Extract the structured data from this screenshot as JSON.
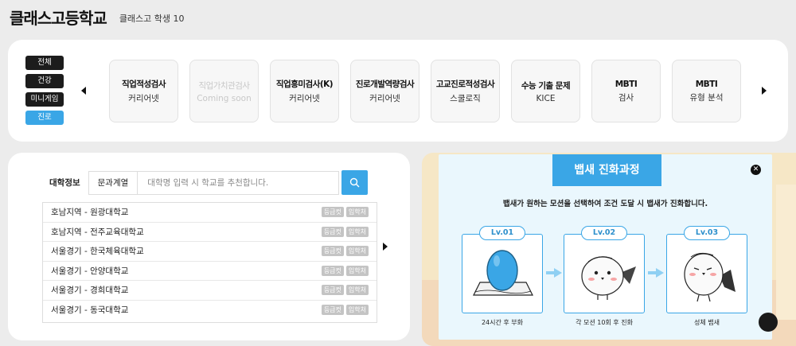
{
  "header": {
    "school_name": "클래스고등학교",
    "student_label": "클래스고 학생 10"
  },
  "categories": [
    {
      "label": "전체",
      "active": false
    },
    {
      "label": "건강",
      "active": false
    },
    {
      "label": "미니게임",
      "active": false
    },
    {
      "label": "진로",
      "active": true
    }
  ],
  "tests": [
    {
      "title": "직업적성검사",
      "sub": "커리어넷",
      "disabled": false
    },
    {
      "title": "직업가치관검사",
      "sub": "Coming soon",
      "disabled": true
    },
    {
      "title": "직업흥미검사(K)",
      "sub": "커리어넷",
      "disabled": false
    },
    {
      "title": "진로개발역량검사",
      "sub": "커리어넷",
      "disabled": false
    },
    {
      "title": "고교진로적성검사",
      "sub": "스쿨로직",
      "disabled": false
    },
    {
      "title": "수능 기출 문제",
      "sub": "KICE",
      "disabled": false
    },
    {
      "title": "MBTI",
      "sub": "검사",
      "disabled": false
    },
    {
      "title": "MBTI",
      "sub": "유형 분석",
      "disabled": false
    }
  ],
  "university": {
    "tab_label": "대학정보",
    "dropdown_value": "문과계열",
    "search_placeholder": "대학명 입력 시 학교를 추천합니다.",
    "tag_grade": "등급컷",
    "tag_admission": "입학처",
    "rows": [
      "호남지역 - 원광대학교",
      "호남지역 - 전주교육대학교",
      "서울경기 - 한국체육대학교",
      "서울경기 - 안양대학교",
      "서울경기 - 경희대학교",
      "서울경기 - 동국대학교"
    ]
  },
  "modal": {
    "title": "뱁새 진화과정",
    "subtitle": "뱁새가 원하는 모션을 선택하여 조건 도달 시 뱁새가 진화합니다.",
    "close_symbol": "✕",
    "levels": [
      {
        "badge": "Lv.01",
        "caption": "24시간 후 부화"
      },
      {
        "badge": "Lv.02",
        "caption": "각 모션 10회 후 진화"
      },
      {
        "badge": "Lv.03",
        "caption": "성체 뱁새"
      }
    ]
  },
  "colors": {
    "accent": "#3aa6e6",
    "dark": "#1c1c1c",
    "tag": "#c4c4c4",
    "promo_bg": "#f6e7c6"
  },
  "icons": {
    "prev": "caret-left-icon",
    "next": "caret-right-icon",
    "search": "magnifier-icon",
    "close": "close-icon"
  }
}
